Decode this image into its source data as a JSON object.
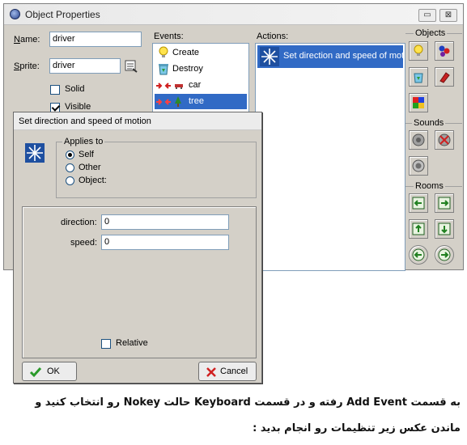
{
  "window": {
    "title": "Object Properties",
    "restore_glyph": "▭",
    "close_glyph": "⊠"
  },
  "left_panel": {
    "name_label": "Name:",
    "name_value": "driver",
    "sprite_label": "Sprite:",
    "sprite_value": "driver",
    "solid_label": "Solid",
    "solid_checked": false,
    "visible_label": "Visible",
    "visible_checked": true
  },
  "events": {
    "header": "Events:",
    "items": [
      {
        "label": "Create",
        "icon": "lightbulb-icon"
      },
      {
        "label": "Destroy",
        "icon": "recycle-bin-icon"
      },
      {
        "label": "car",
        "icon": "collision-icon"
      },
      {
        "label": "tree",
        "icon": "collision-icon",
        "selected": true
      }
    ]
  },
  "actions": {
    "header": "Actions:",
    "items": [
      {
        "label": "Set direction and speed of motion",
        "icon": "motion-arrows-icon"
      }
    ]
  },
  "toolbox": {
    "objects_label": "Objects",
    "sounds_label": "Sounds",
    "rooms_label": "Rooms"
  },
  "dialog": {
    "title": "Set direction and speed of motion",
    "applies_to_label": "Applies to",
    "options": [
      "Self",
      "Other",
      "Object:"
    ],
    "selected_option": "Self",
    "direction_label": "direction:",
    "direction_value": "0",
    "speed_label": "speed:",
    "speed_value": "0",
    "relative_label": "Relative",
    "relative_checked": false,
    "ok_label": "OK",
    "cancel_label": "Cancel"
  },
  "caption": {
    "line1": "به قسمت Add Event رفته و در قسمت Keyboard حالت Nokey رو انتخاب کنید و",
    "line2": "ماندن عکس زیر تنظیمات رو انجام بدید :"
  }
}
